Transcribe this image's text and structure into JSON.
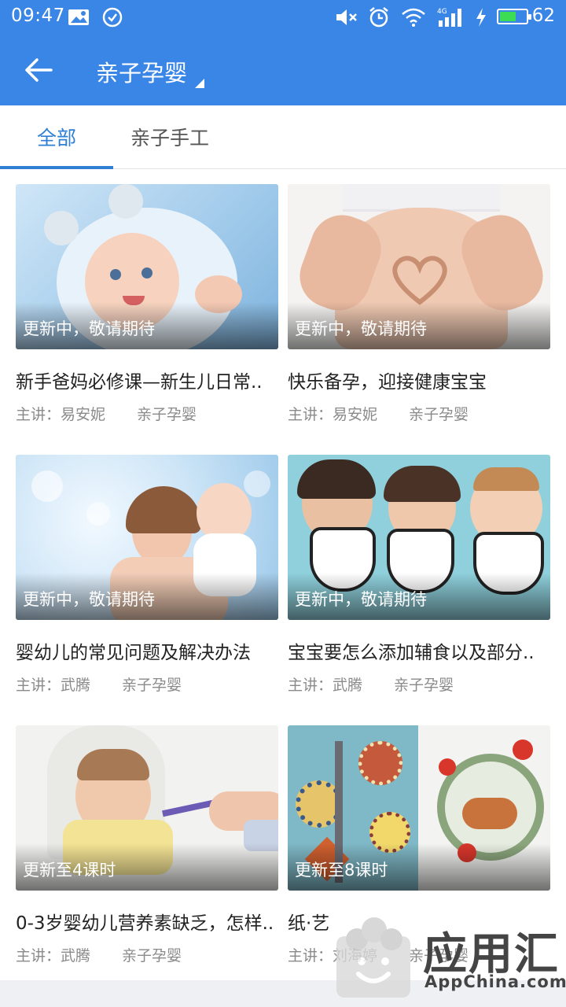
{
  "status_bar": {
    "time": "09:47",
    "battery": "62",
    "battery_level_percent": 62,
    "network": "4G",
    "icons": [
      "image-icon",
      "check-circle-icon",
      "mute-icon",
      "alarm-icon",
      "wifi-icon",
      "signal-icon",
      "charging-icon",
      "battery-icon"
    ]
  },
  "app_bar": {
    "back_icon": "arrow-left-icon",
    "title": "亲子孕婴"
  },
  "tabs": [
    {
      "label": "全部",
      "active": true
    },
    {
      "label": "亲子手工",
      "active": false
    }
  ],
  "courses": [
    {
      "status": "更新中，敬请期待",
      "title": "新手爸妈必修课—新生儿日常..",
      "lecturer": "主讲：易安妮",
      "category": "亲子孕婴"
    },
    {
      "status": "更新中，敬请期待",
      "title": "快乐备孕，迎接健康宝宝",
      "lecturer": "主讲：易安妮",
      "category": "亲子孕婴"
    },
    {
      "status": "更新中，敬请期待",
      "title": "婴幼儿的常见问题及解决办法",
      "lecturer": "主讲：武腾",
      "category": "亲子孕婴"
    },
    {
      "status": "更新中，敬请期待",
      "title": "宝宝要怎么添加辅食以及部分..",
      "lecturer": "主讲：武腾",
      "category": "亲子孕婴"
    },
    {
      "status": "更新至4课时",
      "title": "0-3岁婴幼儿营养素缺乏，怎样..",
      "lecturer": "主讲：武腾",
      "category": "亲子孕婴"
    },
    {
      "status": "更新至8课时",
      "title": "纸·艺",
      "lecturer": "主讲：刘海婷",
      "category": "亲子孕婴"
    }
  ],
  "watermark": {
    "text": "应用汇",
    "sub": "AppChina.com"
  },
  "colors": {
    "primary": "#3a86e6",
    "tab_active": "#2f7fd4",
    "battery_fill": "#3ddc55"
  }
}
